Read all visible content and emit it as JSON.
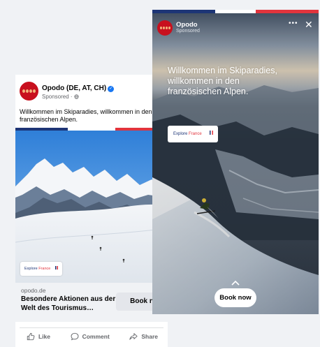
{
  "feed_post": {
    "page_name": "Opodo (DE, AT, CH)",
    "sponsored": "Sponsored · ἰE",
    "sponsored_label": "Sponsored ·",
    "more": "•••",
    "text": "Willkommen im Skiparadies, willkommen in den französischen Alpen.",
    "badge_explore": "Explore",
    "badge_france": "France",
    "domain": "opodo.de",
    "headline": "Besondere Aktionen aus der Welt des Tourismus…",
    "cta": "Book now",
    "actions": {
      "like": "Like",
      "comment": "Comment",
      "share": "Share"
    }
  },
  "story": {
    "page_name": "Opodo",
    "sponsored": "Sponsored",
    "more": "•••",
    "text": "Willkommen im Skiparadies, willkommen in den französischen Alpen.",
    "badge_explore": "Explore",
    "badge_france": "France",
    "cta": "Book now"
  },
  "icons": [
    "verified-icon",
    "globe-icon",
    "like-icon",
    "comment-icon",
    "share-icon",
    "close-icon",
    "chevron-up-icon"
  ],
  "colors": {
    "brand_red": "#c8101e",
    "flag_blue": "#1d3576",
    "flag_red": "#e1343d",
    "verified": "#1877f2"
  }
}
